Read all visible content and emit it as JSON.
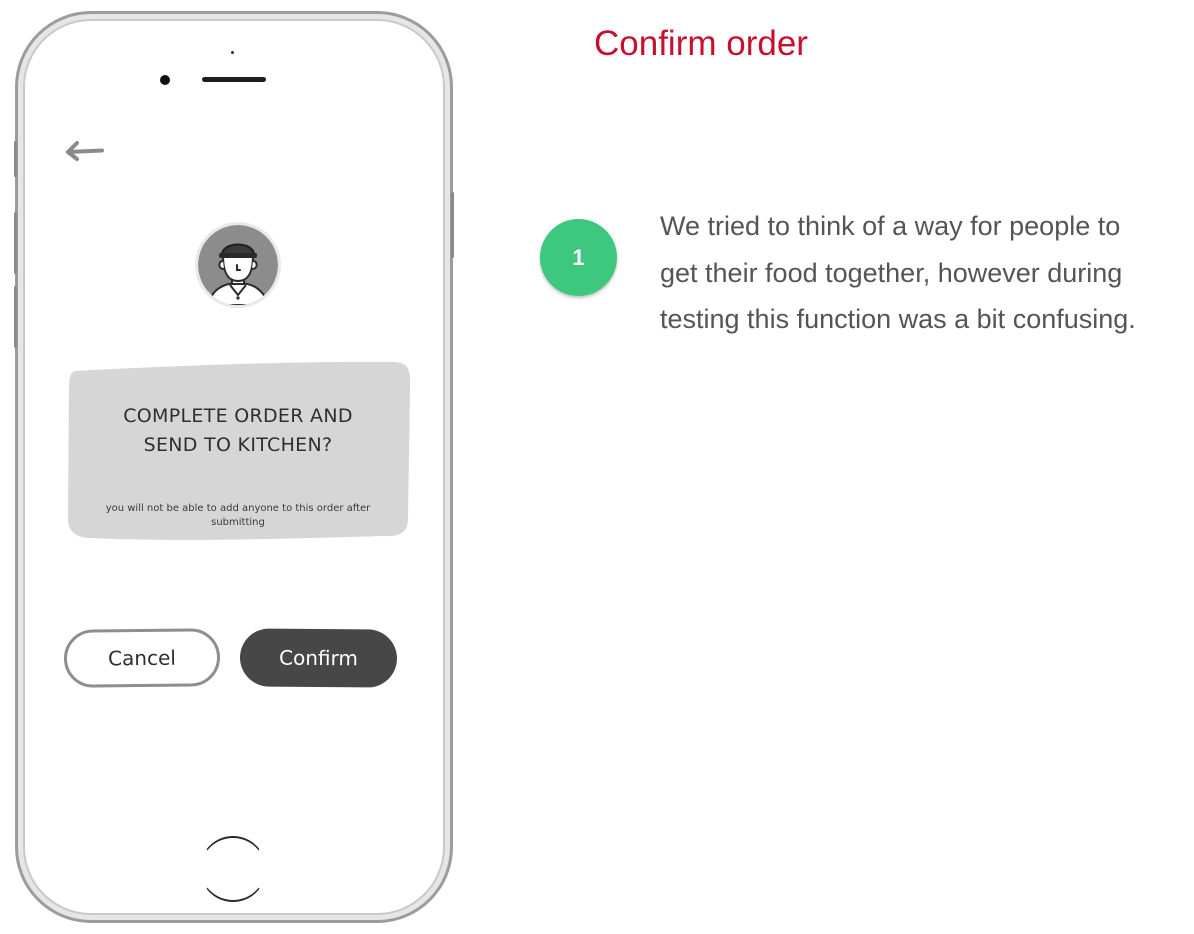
{
  "page": {
    "title": "Confirm order"
  },
  "phone": {
    "dialog": {
      "title": "COMPLETE ORDER AND\nSEND TO KITCHEN?",
      "note": "you will not be able to add anyone to this order after submitting"
    },
    "buttons": {
      "cancel_label": "Cancel",
      "confirm_label": "Confirm"
    },
    "icons": {
      "back": "arrow-left-icon",
      "avatar": "chef-avatar-icon"
    }
  },
  "annotation": {
    "step_number": "1",
    "text": "We tried to think of a way for people to get their food together, however during testing this function was a bit confusing."
  },
  "colors": {
    "title": "#c8102e",
    "badge": "#3ec77f",
    "confirm_button": "#474747",
    "card": "#d6d6d6",
    "body_text": "#555555"
  }
}
